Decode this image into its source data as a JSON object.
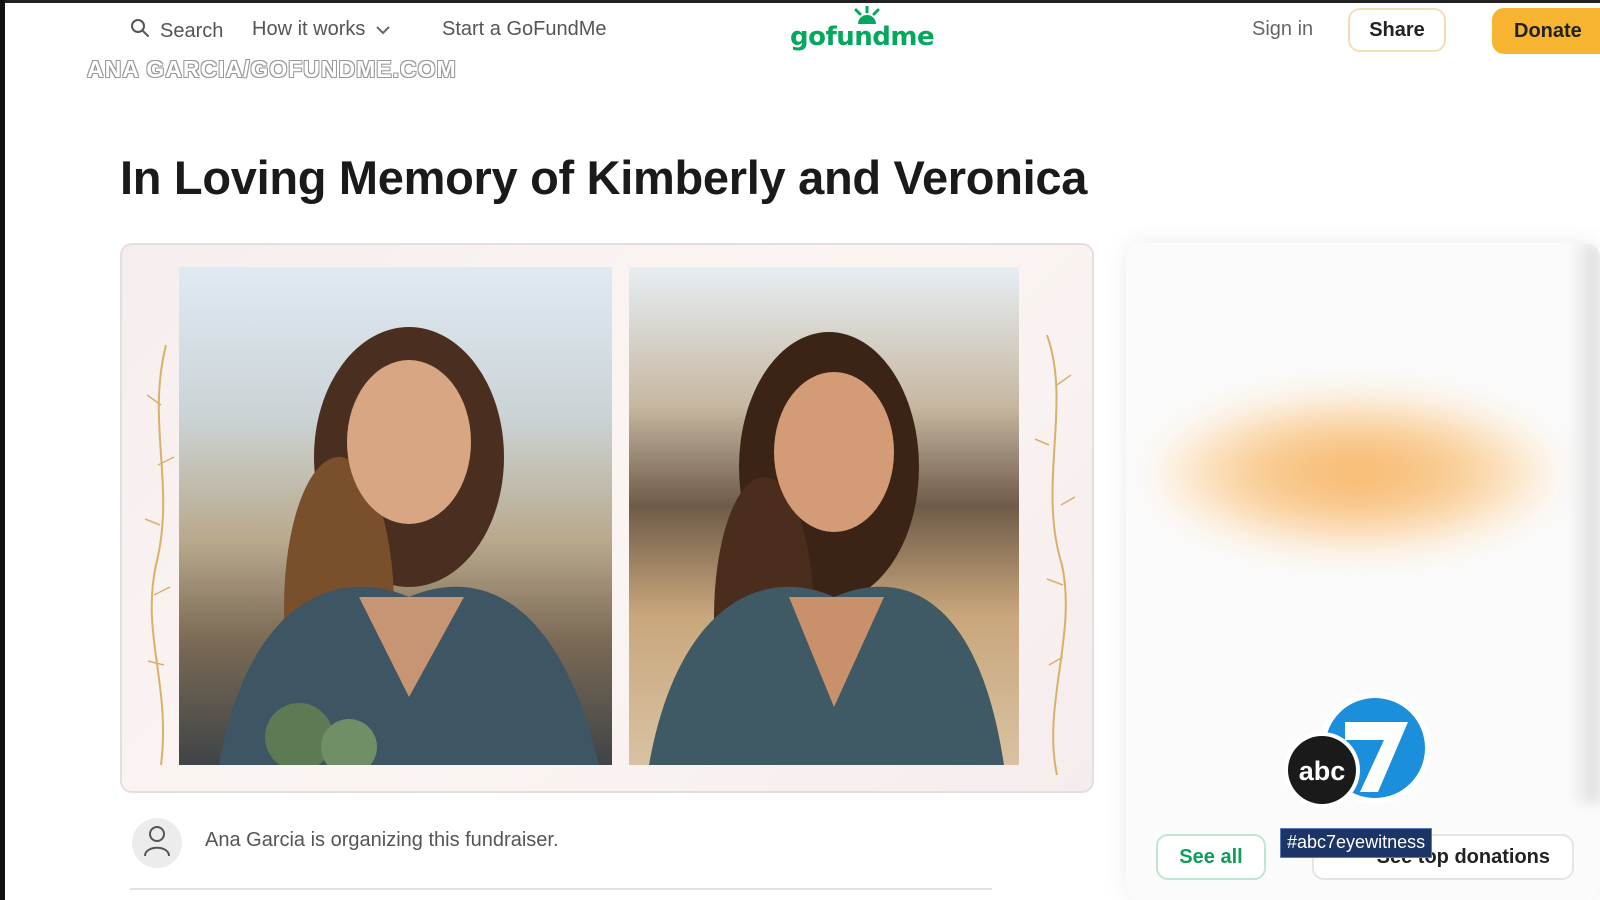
{
  "header": {
    "search_label": "Search",
    "how_it_works_label": "How it works",
    "start_label": "Start a GoFundMe",
    "logo_text": "gofundme",
    "signin_label": "Sign in",
    "share_label": "Share",
    "donate_label": "Donate"
  },
  "watermark": "ANA GARCIA/GOFUNDME.COM",
  "page": {
    "title": "In Loving Memory of Kimberly and Veronica"
  },
  "organizer": {
    "text": "Ana Garcia is organizing this fundraiser."
  },
  "sidebar": {
    "see_all_label": "See all",
    "top_donations_label": "See top donations"
  },
  "overlay": {
    "network_logo": "abc7",
    "hashtag": "#abc7eyewitness"
  },
  "colors": {
    "brand_green": "#02a95c",
    "donate_yellow": "#f6b431",
    "abc_navy": "#1d3466"
  }
}
